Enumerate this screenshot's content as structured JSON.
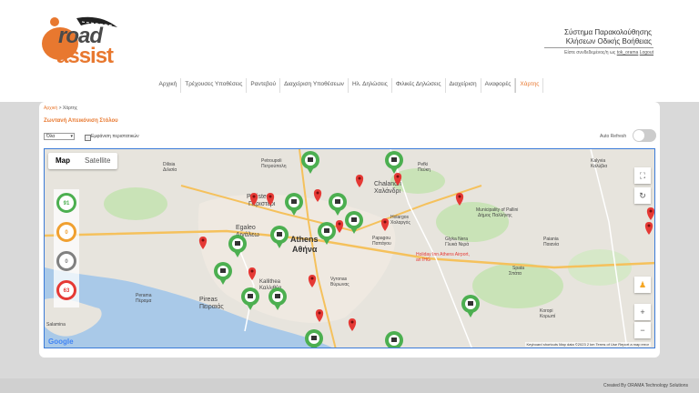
{
  "header": {
    "logo_road": "road",
    "logo_assist": "assist",
    "system_title_line1": "Σύστημα Παρακολούθησης",
    "system_title_line2": "Κλήσεων Οδικής Βοήθειας",
    "login_text": "Είστε συνδεδεμένος/η ως",
    "login_user": "tok_orama",
    "logout_label": "Logout"
  },
  "nav": {
    "items": [
      {
        "label": "Αρχική"
      },
      {
        "label": "Τρέχουσες Υποθέσεις"
      },
      {
        "label": "Ραντεβού"
      },
      {
        "label": "Διαχείριση Υποθέσεων"
      },
      {
        "label": "Ηλ. Δηλώσεις"
      },
      {
        "label": "Φιλικές Δηλώσεις"
      },
      {
        "label": "Διαχείριση"
      },
      {
        "label": "Αναφορές"
      },
      {
        "label": "Χάρτης"
      }
    ],
    "active": "Χάρτης"
  },
  "breadcrumb": {
    "home": "Αρχική",
    "sep": ">",
    "current": "Χάρτης"
  },
  "section_title": "Ζωντανή Απεικόνιση Στόλου",
  "filter": {
    "selected": "Όλα",
    "checkbox_label": "Εμφάνιση περιστατικών",
    "auto_refresh_label": "Auto Refresh"
  },
  "map": {
    "type_buttons": [
      "Map",
      "Satellite"
    ],
    "legend_counts": [
      "91",
      "0",
      "0",
      "63"
    ],
    "legend_colors": [
      "#4caf50",
      "#f0a030",
      "#808080",
      "#e53935"
    ],
    "labels": {
      "athens": "Athens",
      "athens_gr": "Αθήνα",
      "peristeri": "Peristeri",
      "peristeri_gr": "Περιστέρι",
      "chalandri": "Chalandri",
      "chalandri_gr": "Χαλάνδρι",
      "egaleo": "Egaleo",
      "egaleo_gr": "Αιγάλεω",
      "pireas": "Pireas",
      "pireas_gr": "Πειραιάς",
      "salamina": "Salamina",
      "holargos": "Holargos",
      "holargos_gr": "Χολαργός",
      "papagou": "Papagou",
      "papagou_gr": "Παπάγου",
      "vyronas": "Vyronas",
      "vyronas_gr": "Βύρωνας",
      "kallithea": "Kallithea",
      "kallithea_gr": "Καλλιθέα",
      "pallini": "Municipality of Pallini",
      "pallini_gr": "Δήμος Παλλήνης",
      "spata": "Spata",
      "spata_gr": "Σπάτα",
      "koropi": "Koropi",
      "koropi_gr": "Κορωπί",
      "pefki": "Pefki",
      "pefki_gr": "Πεύκη",
      "dilisia": "Dilisia",
      "dilisia_gr": "Διλισία",
      "perama": "Perama",
      "perama_gr": "Πέραμα",
      "glyka_nera": "Glyka Nera",
      "glyka_nera_gr": "Γλυκά Νερά",
      "paiania": "Paiania",
      "paiania_gr": "Παιανία",
      "petroupoli": "Petroupoli",
      "petroupoli_gr": "Πετρούπολη",
      "kalyvia": "Kalyvia",
      "kalyvia_gr": "Καλύβια",
      "holiday_inn": "Holiday Inn Athens Airport, an IHG"
    },
    "copyright": "Keyboard shortcuts   Map data ©2023   2 km   Terms of Use   Report a map error",
    "google_label": "Google"
  },
  "footer": {
    "credit": "Created By ORAMA Technology Solutions"
  }
}
